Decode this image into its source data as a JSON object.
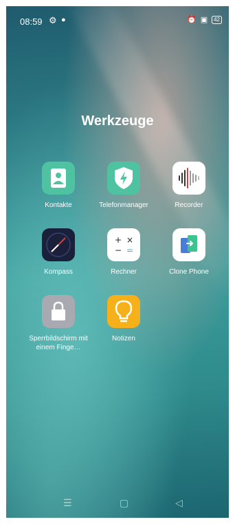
{
  "status_bar": {
    "time": "08:59",
    "battery": "42"
  },
  "folder": {
    "title": "Werkzeuge"
  },
  "apps": [
    {
      "label": "Kontakte",
      "icon": "contacts-icon",
      "color": "#4fc3a1"
    },
    {
      "label": "Telefonmanager",
      "icon": "shield-bolt-icon",
      "color": "#4fc3a1"
    },
    {
      "label": "Recorder",
      "icon": "soundwave-icon",
      "color": "#ffffff"
    },
    {
      "label": "Kompass",
      "icon": "compass-icon",
      "color": "#1a1f3a"
    },
    {
      "label": "Rechner",
      "icon": "calculator-icon",
      "color": "#ffffff"
    },
    {
      "label": "Clone Phone",
      "icon": "clone-phone-icon",
      "color": "#ffffff"
    },
    {
      "label": "Sperrbildschirm mit einem Finge…",
      "icon": "lock-icon",
      "color": "#a9a9b2"
    },
    {
      "label": "Notizen",
      "icon": "lightbulb-icon",
      "color": "#f6b11a"
    }
  ],
  "nav_bar": {
    "menu": "☰",
    "home": "▢",
    "back": "◁"
  }
}
